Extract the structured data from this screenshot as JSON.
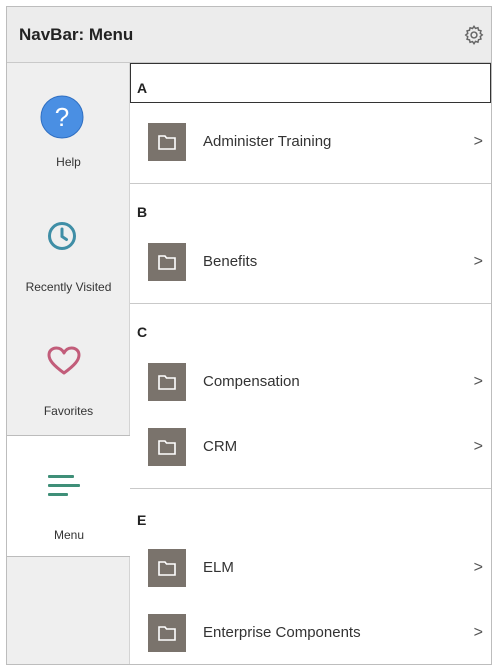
{
  "header": {
    "title": "NavBar: Menu",
    "settings_icon": "gear-icon"
  },
  "sidebar": {
    "items": [
      {
        "label": "Help",
        "icon": "help-icon",
        "color": "#4a8fe3"
      },
      {
        "label": "Recently Visited",
        "icon": "clock-icon",
        "color": "#3f8ea6"
      },
      {
        "label": "Favorites",
        "icon": "heart-icon",
        "color": "#c25d7a"
      },
      {
        "label": "Menu",
        "icon": "menu-icon",
        "color": "#3f8f78",
        "active": true
      }
    ]
  },
  "menu": {
    "groups": [
      {
        "letter": "A",
        "items": [
          {
            "label": "Administer Training",
            "icon": "folder-icon"
          }
        ]
      },
      {
        "letter": "B",
        "items": [
          {
            "label": "Benefits",
            "icon": "folder-icon"
          }
        ]
      },
      {
        "letter": "C",
        "items": [
          {
            "label": "Compensation",
            "icon": "folder-icon"
          },
          {
            "label": "CRM",
            "icon": "folder-icon"
          }
        ]
      },
      {
        "letter": "E",
        "items": [
          {
            "label": "ELM",
            "icon": "folder-icon"
          },
          {
            "label": "Enterprise Components",
            "icon": "folder-icon"
          }
        ]
      }
    ],
    "chevron": ">"
  }
}
